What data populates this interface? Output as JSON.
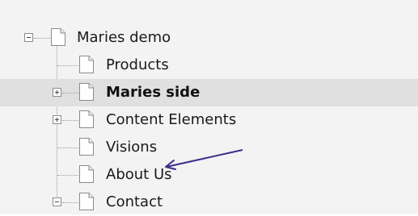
{
  "tree": {
    "root": {
      "label": "Maries demo",
      "state": "expanded"
    },
    "items": [
      {
        "label": "Products",
        "state": "leaf",
        "selected": false,
        "bold": false
      },
      {
        "label": "Maries side",
        "state": "collapsed",
        "selected": true,
        "bold": true
      },
      {
        "label": "Content Elements",
        "state": "collapsed",
        "selected": false,
        "bold": false
      },
      {
        "label": "Visions",
        "state": "leaf",
        "selected": false,
        "bold": false
      },
      {
        "label": "About Us",
        "state": "leaf",
        "selected": false,
        "bold": false
      },
      {
        "label": "Contact",
        "state": "expanded",
        "selected": false,
        "bold": false
      }
    ]
  },
  "annotation": {
    "type": "arrow",
    "color": "#3a2e8a",
    "points_to": "About Us"
  },
  "colors": {
    "background": "#f3f3f3",
    "selected_row": "#e0e0e0",
    "text": "#1a1a1a"
  },
  "icons": {
    "page": "page-icon",
    "expand": "plus-icon",
    "collapse": "minus-icon"
  }
}
